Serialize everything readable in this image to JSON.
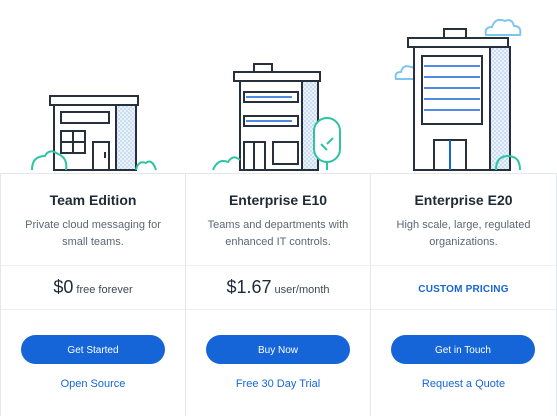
{
  "colors": {
    "accent": "#1565d8",
    "outline": "#27313d",
    "building_fill": "#ffffff",
    "dotted_wall": "#cfe0f4",
    "plant": "#2cc4a3",
    "cloud": "#7cc6ee"
  },
  "plans": [
    {
      "name": "Team Edition",
      "description": "Private cloud messaging for small teams.",
      "price": "$0",
      "price_suffix": "free forever",
      "button": "Get Started",
      "link": "Open Source"
    },
    {
      "name": "Enterprise E10",
      "description": "Teams and departments with enhanced IT controls.",
      "price": "$1.67",
      "price_suffix": "user/month",
      "button": "Buy Now",
      "link": "Free 30 Day Trial"
    },
    {
      "name": "Enterprise E20",
      "description": "High scale, large, regulated organizations.",
      "price_label": "CUSTOM PRICING",
      "button": "Get in Touch",
      "link": "Request a Quote"
    }
  ]
}
